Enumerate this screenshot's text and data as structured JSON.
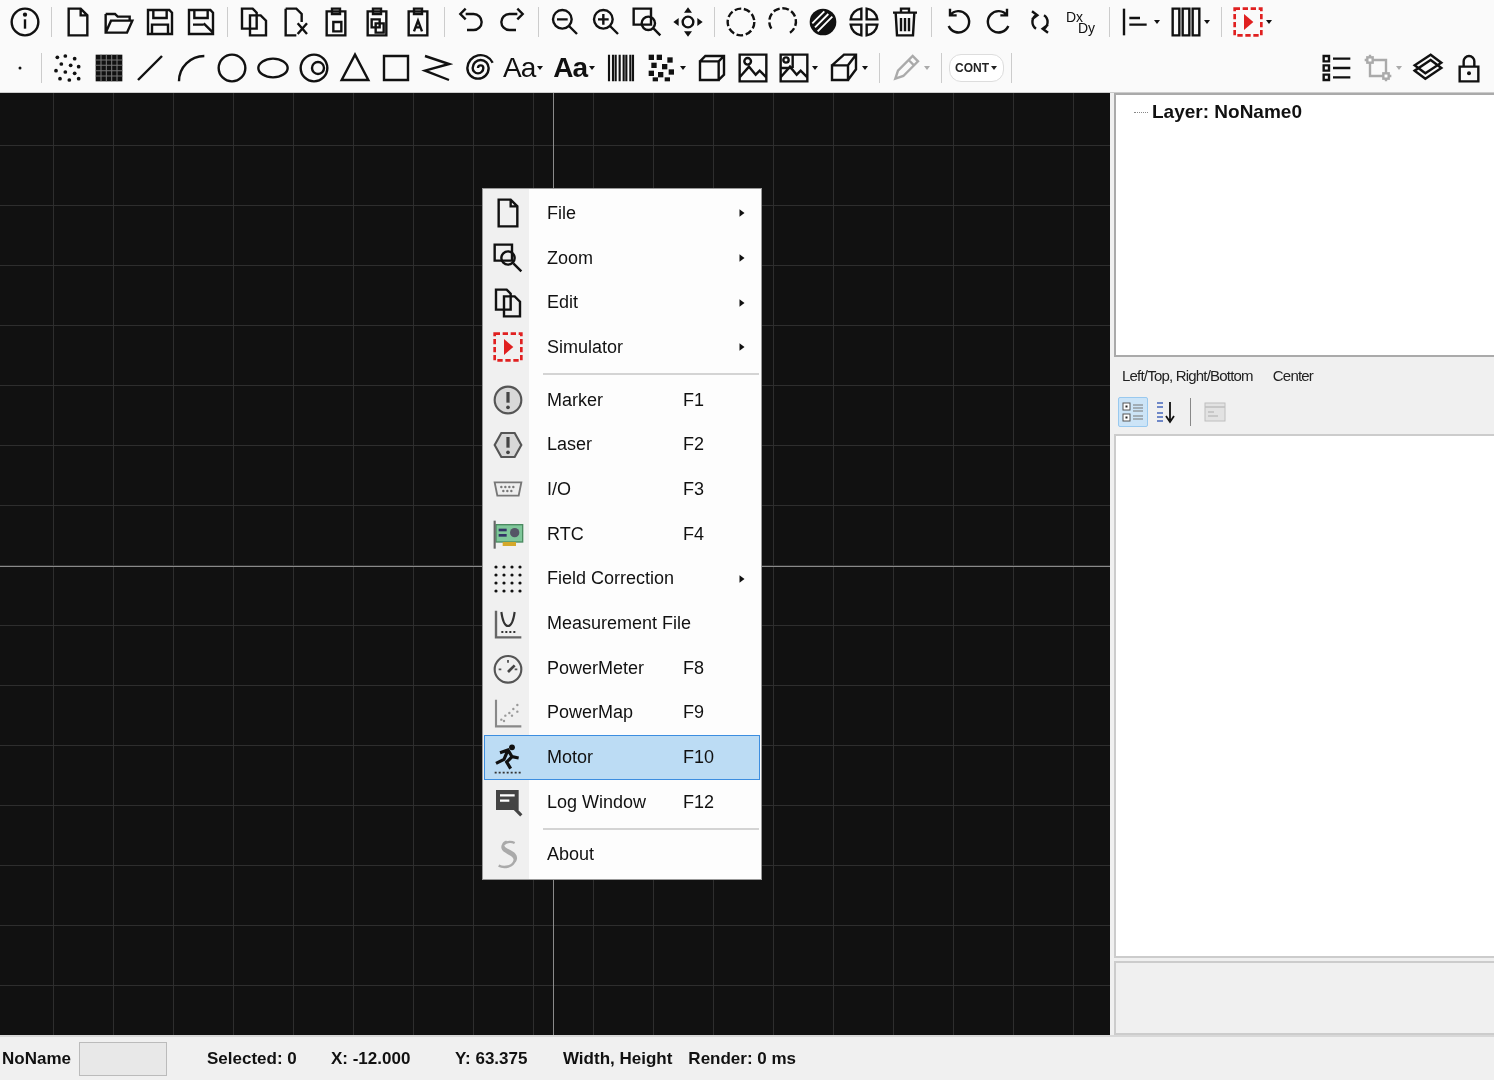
{
  "toolbar_top": [
    {
      "kind": "button",
      "dropdown": false
    },
    {
      "kind": "separator"
    },
    {
      "kind": "button",
      "dropdown": false
    },
    {
      "kind": "button",
      "dropdown": false
    },
    {
      "kind": "button",
      "dropdown": false
    },
    {
      "kind": "button",
      "dropdown": false
    },
    {
      "kind": "separator"
    },
    {
      "kind": "button",
      "dropdown": false
    },
    {
      "kind": "button",
      "dropdown": false
    },
    {
      "kind": "button",
      "dropdown": false
    },
    {
      "kind": "button",
      "dropdown": false
    },
    {
      "kind": "button",
      "dropdown": false
    },
    {
      "kind": "separator"
    },
    {
      "kind": "button",
      "dropdown": false
    },
    {
      "kind": "button",
      "dropdown": false
    },
    {
      "kind": "separator"
    },
    {
      "kind": "button",
      "dropdown": false
    },
    {
      "kind": "button",
      "dropdown": false
    },
    {
      "kind": "button",
      "dropdown": false
    },
    {
      "kind": "button",
      "dropdown": false
    },
    {
      "kind": "separator"
    },
    {
      "kind": "button",
      "dropdown": false
    },
    {
      "kind": "button",
      "dropdown": false
    },
    {
      "kind": "button",
      "dropdown": false
    },
    {
      "kind": "button",
      "dropdown": false
    },
    {
      "kind": "button",
      "dropdown": false
    },
    {
      "kind": "separator"
    },
    {
      "kind": "button",
      "dropdown": false
    },
    {
      "kind": "button",
      "dropdown": false
    },
    {
      "kind": "button",
      "dropdown": false
    },
    {
      "kind": "stack",
      "labels": [
        "Dx",
        "Dy"
      ]
    },
    {
      "kind": "separator"
    },
    {
      "kind": "button",
      "dropdown": true
    },
    {
      "kind": "button",
      "dropdown": true
    },
    {
      "kind": "separator"
    },
    {
      "kind": "button",
      "dropdown": true
    }
  ],
  "toolbar_bottom": {
    "left": [
      {
        "kind": "button",
        "dropdown": false,
        "disabled": false
      },
      {
        "kind": "separator"
      },
      {
        "kind": "button",
        "dropdown": false,
        "disabled": false
      },
      {
        "kind": "button",
        "dropdown": false,
        "disabled": false
      },
      {
        "kind": "button",
        "dropdown": false,
        "disabled": false
      },
      {
        "kind": "button",
        "dropdown": false,
        "disabled": false
      },
      {
        "kind": "button",
        "dropdown": false,
        "disabled": false
      },
      {
        "kind": "button",
        "dropdown": false,
        "disabled": false
      },
      {
        "kind": "button",
        "dropdown": false,
        "disabled": false
      },
      {
        "kind": "button",
        "dropdown": false,
        "disabled": false
      },
      {
        "kind": "button",
        "dropdown": false,
        "disabled": false
      },
      {
        "kind": "button",
        "dropdown": false,
        "disabled": false
      },
      {
        "kind": "button",
        "dropdown": false,
        "disabled": false
      },
      {
        "kind": "text",
        "label": "Aa",
        "bold": false,
        "dropdown": true
      },
      {
        "kind": "text",
        "label": "Aa",
        "bold": true,
        "dropdown": true
      },
      {
        "kind": "button",
        "dropdown": false,
        "disabled": false
      },
      {
        "kind": "button",
        "dropdown": true,
        "disabled": false
      },
      {
        "kind": "button",
        "dropdown": false,
        "disabled": false
      },
      {
        "kind": "button",
        "dropdown": false,
        "disabled": false
      },
      {
        "kind": "button",
        "dropdown": true,
        "disabled": false
      },
      {
        "kind": "button",
        "dropdown": true,
        "disabled": false
      },
      {
        "kind": "separator"
      },
      {
        "kind": "button",
        "dropdown": true,
        "disabled": true
      },
      {
        "kind": "separator"
      },
      {
        "kind": "chip",
        "label": "CONT",
        "dropdown": true
      },
      {
        "kind": "separator"
      }
    ],
    "right": [
      {
        "kind": "button",
        "dropdown": false,
        "disabled": false
      },
      {
        "kind": "button",
        "dropdown": true,
        "disabled": true
      },
      {
        "kind": "button",
        "dropdown": false,
        "disabled": false
      },
      {
        "kind": "button",
        "dropdown": false,
        "disabled": false
      }
    ]
  },
  "context_menu": [
    {
      "kind": "item",
      "label": "File",
      "submenu": true,
      "selected": false
    },
    {
      "kind": "item",
      "label": "Zoom",
      "submenu": true,
      "selected": false
    },
    {
      "kind": "item",
      "label": "Edit",
      "submenu": true,
      "selected": false
    },
    {
      "kind": "item",
      "label": "Simulator",
      "submenu": true,
      "selected": false
    },
    {
      "kind": "separator"
    },
    {
      "kind": "item",
      "label": "Marker",
      "shortcut": "F1",
      "submenu": false,
      "selected": false
    },
    {
      "kind": "item",
      "label": "Laser",
      "shortcut": "F2",
      "submenu": false,
      "selected": false
    },
    {
      "kind": "item",
      "label": "I/O",
      "shortcut": "F3",
      "submenu": false,
      "selected": false
    },
    {
      "kind": "item",
      "label": "RTC",
      "shortcut": "F4",
      "submenu": false,
      "selected": false
    },
    {
      "kind": "item",
      "label": "Field Correction",
      "submenu": true,
      "selected": false
    },
    {
      "kind": "item",
      "label": "Measurement File",
      "submenu": false,
      "selected": false
    },
    {
      "kind": "item",
      "label": "PowerMeter",
      "shortcut": "F8",
      "submenu": false,
      "selected": false
    },
    {
      "kind": "item",
      "label": "PowerMap",
      "shortcut": "F9",
      "submenu": false,
      "selected": false
    },
    {
      "kind": "item",
      "label": "Motor",
      "shortcut": "F10",
      "submenu": false,
      "selected": true
    },
    {
      "kind": "item",
      "label": "Log Window",
      "shortcut": "F12",
      "submenu": false,
      "selected": false
    },
    {
      "kind": "separator"
    },
    {
      "kind": "item",
      "label": "About",
      "submenu": false,
      "selected": false
    }
  ],
  "layer_tree": {
    "items": [
      {
        "label": "Layer: NoName0"
      }
    ]
  },
  "property_tabs": [
    {
      "label": "Left/Top, Right/Bottom"
    },
    {
      "label": "Center"
    }
  ],
  "property_toolbar": [
    {
      "selected": true,
      "disabled": false
    },
    {
      "selected": false,
      "disabled": false
    },
    {
      "selected": false,
      "disabled": true
    }
  ],
  "status_bar": {
    "document": "NoName",
    "selected": "Selected: 0",
    "x": "X: -12.000",
    "y": "Y: 63.375",
    "size": "Width, Height",
    "render": "Render: 0 ms"
  }
}
